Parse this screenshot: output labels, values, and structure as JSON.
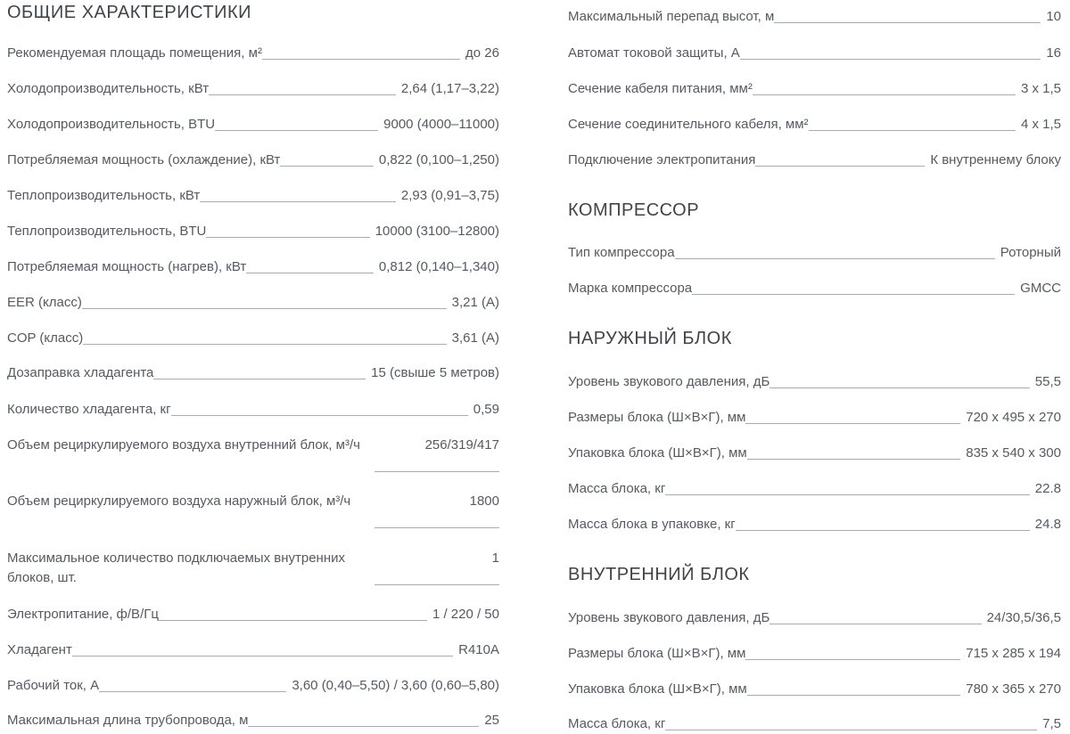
{
  "left": {
    "title": "ОБЩИЕ ХАРАКТЕРИСТИКИ",
    "rows": [
      {
        "label": "Рекомендуемая площадь помещения, м²",
        "value": "до 26"
      },
      {
        "label": "Холодопроизводительность, кВт",
        "value": "2,64 (1,17–3,22)"
      },
      {
        "label": "Холодопроизводительность, BTU",
        "value": "9000 (4000–11000)"
      },
      {
        "label": "Потребляемая мощность (охлаждение), кВт",
        "value": "0,822 (0,100–1,250)"
      },
      {
        "label": "Теплопроизводительность, кВт",
        "value": "2,93 (0,91–3,75)"
      },
      {
        "label": "Теплопроизводительность, BTU",
        "value": "10000 (3100–12800)"
      },
      {
        "label": "Потребляемая мощность (нагрев), кВт",
        "value": "0,812 (0,140–1,340)"
      },
      {
        "label": "EER (класс)",
        "value": "3,21 (A)"
      },
      {
        "label": "COP (класс)",
        "value": "3,61 (A)"
      },
      {
        "label": "Дозаправка хладагента",
        "value": "15 (свыше 5 метров)"
      },
      {
        "label": "Количество хладагента, кг",
        "value": "0,59"
      },
      {
        "label": "Объем рециркулируемого воздуха внутренний блок, м³/ч",
        "value": "256/319/417"
      },
      {
        "label": "Объем рециркулируемого воздуха наружный блок, м³/ч",
        "value": "1800"
      },
      {
        "label": "Максимальное количество подключаемых внутренних блоков, шт.",
        "value": "1"
      },
      {
        "label": "Электропитание, ф/В/Гц",
        "value": "1 / 220 / 50"
      },
      {
        "label": "Хладагент",
        "value": "R410A"
      },
      {
        "label": "Рабочий ток, А",
        "value": "3,60 (0,40–5,50) / 3,60 (0,60–5,80)"
      },
      {
        "label": "Максимальная длина трубопровода, м",
        "value": "25"
      }
    ]
  },
  "right": {
    "top_rows": [
      {
        "label": "Максимальный перепад высот, м",
        "value": "10"
      },
      {
        "label": "Автомат токовой защиты, А",
        "value": "16"
      },
      {
        "label": "Сечение кабеля питания, мм²",
        "value": "3 x 1,5"
      },
      {
        "label": "Сечение соединительного кабеля, мм²",
        "value": "4 x 1,5"
      },
      {
        "label": "Подключение электропитания",
        "value": "К внутреннему блоку"
      }
    ],
    "compressor": {
      "title": "КОМПРЕССОР",
      "rows": [
        {
          "label": "Тип компрессора",
          "value": "Роторный"
        },
        {
          "label": "Марка компрессора",
          "value": "GMCC"
        }
      ]
    },
    "outdoor": {
      "title": "НАРУЖНЫЙ БЛОК",
      "rows": [
        {
          "label": "Уровень звукового давления, дБ",
          "value": "55,5"
        },
        {
          "label": "Размеры блока (Ш×В×Г), мм",
          "value": "720 x 495 x 270"
        },
        {
          "label": "Упаковка блока (Ш×В×Г), мм",
          "value": "835 x 540 x 300"
        },
        {
          "label": "Масса блока, кг",
          "value": "22.8"
        },
        {
          "label": "Масса блока в упаковке, кг",
          "value": "24.8"
        }
      ]
    },
    "indoor": {
      "title": "ВНУТРЕННИЙ БЛОК",
      "rows": [
        {
          "label": "Уровень звукового давления, дБ",
          "value": "24/30,5/36,5"
        },
        {
          "label": "Размеры блока (Ш×В×Г), мм",
          "value": "715 x 285 x 194"
        },
        {
          "label": "Упаковка блока (Ш×В×Г), мм",
          "value": "780 x 365 x 270"
        },
        {
          "label": "Масса блока, кг",
          "value": "7,5"
        }
      ]
    }
  }
}
